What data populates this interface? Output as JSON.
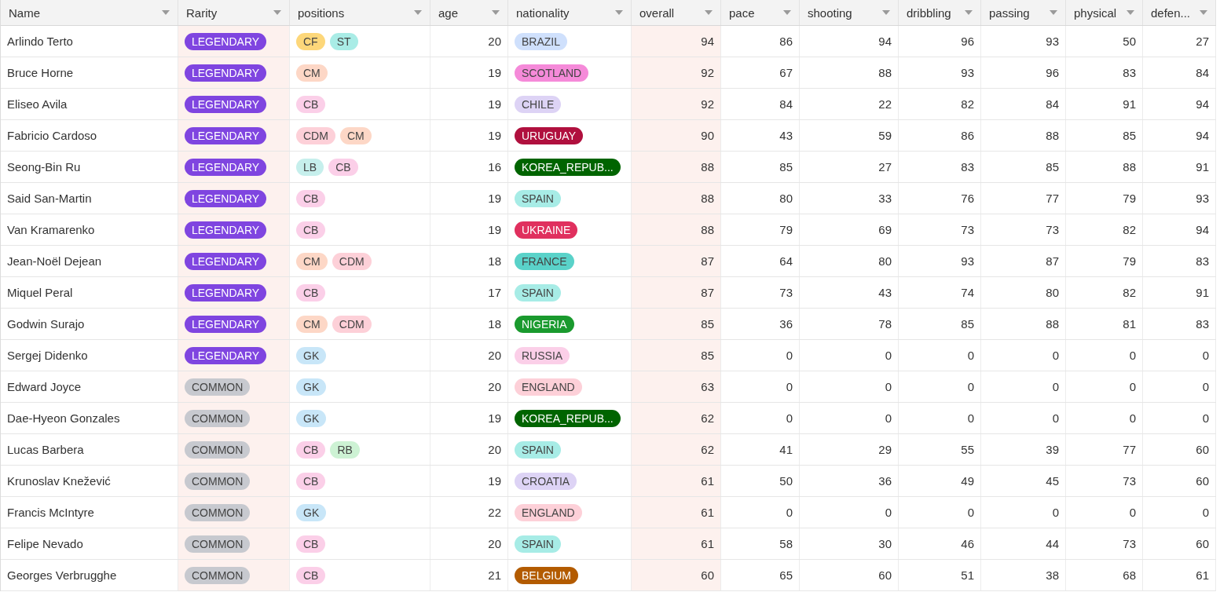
{
  "table": {
    "columns": [
      {
        "label": "Name",
        "kind": "text",
        "highlighted": false
      },
      {
        "label": "Rarity",
        "kind": "tag",
        "highlighted": true
      },
      {
        "label": "positions",
        "kind": "tags",
        "highlighted": false
      },
      {
        "label": "age",
        "kind": "number",
        "highlighted": false
      },
      {
        "label": "nationality",
        "kind": "tag",
        "highlighted": false
      },
      {
        "label": "overall",
        "kind": "number",
        "highlighted": true
      },
      {
        "label": "pace",
        "kind": "number",
        "highlighted": false
      },
      {
        "label": "shooting",
        "kind": "number",
        "highlighted": false
      },
      {
        "label": "dribbling",
        "kind": "number",
        "highlighted": false
      },
      {
        "label": "passing",
        "kind": "number",
        "highlighted": false
      },
      {
        "label": "physical",
        "kind": "number",
        "highlighted": false
      },
      {
        "label": "defen...",
        "kind": "number",
        "highlighted": false
      }
    ],
    "rows": [
      {
        "cells": [
          "Arlindo Terto",
          {
            "text": "LEGENDARY",
            "color": "#7f45e0"
          },
          [
            {
              "text": "CF",
              "color": "#fdd77a"
            },
            {
              "text": "ST",
              "color": "#a9ece6"
            }
          ],
          "20",
          {
            "text": "BRAZIL",
            "color": "#cfe0fc"
          },
          "94",
          "86",
          "94",
          "96",
          "93",
          "50",
          "27"
        ]
      },
      {
        "cells": [
          "Bruce Horne",
          {
            "text": "LEGENDARY",
            "color": "#7f45e0"
          },
          [
            {
              "text": "CM",
              "color": "#fdd7c6"
            }
          ],
          "19",
          {
            "text": "SCOTLAND",
            "color": "#f58ad9"
          },
          "92",
          "67",
          "88",
          "93",
          "96",
          "83",
          "84"
        ]
      },
      {
        "cells": [
          "Eliseo Avila",
          {
            "text": "LEGENDARY",
            "color": "#7f45e0"
          },
          [
            {
              "text": "CB",
              "color": "#fbcfe8"
            }
          ],
          "19",
          {
            "text": "CHILE",
            "color": "#ddd3f5"
          },
          "92",
          "84",
          "22",
          "82",
          "84",
          "91",
          "94"
        ]
      },
      {
        "cells": [
          "Fabricio Cardoso",
          {
            "text": "LEGENDARY",
            "color": "#7f45e0"
          },
          [
            {
              "text": "CDM",
              "color": "#fdd0d8"
            },
            {
              "text": "CM",
              "color": "#fdd7c6"
            }
          ],
          "19",
          {
            "text": "URUGUAY",
            "color": "#b0103e"
          },
          "90",
          "43",
          "59",
          "86",
          "88",
          "85",
          "94"
        ]
      },
      {
        "cells": [
          "Seong-Bin Ru",
          {
            "text": "LEGENDARY",
            "color": "#7f45e0"
          },
          [
            {
              "text": "LB",
              "color": "#c6efec"
            },
            {
              "text": "CB",
              "color": "#fbcfe8"
            }
          ],
          "16",
          {
            "text": "KOREA_REPUB...",
            "color": "#006400"
          },
          "88",
          "85",
          "27",
          "83",
          "85",
          "88",
          "91"
        ]
      },
      {
        "cells": [
          "Said San-Martin",
          {
            "text": "LEGENDARY",
            "color": "#7f45e0"
          },
          [
            {
              "text": "CB",
              "color": "#fbcfe8"
            }
          ],
          "19",
          {
            "text": "SPAIN",
            "color": "#a7ece6"
          },
          "88",
          "80",
          "33",
          "76",
          "77",
          "79",
          "93"
        ]
      },
      {
        "cells": [
          "Van Kramarenko",
          {
            "text": "LEGENDARY",
            "color": "#7f45e0"
          },
          [
            {
              "text": "CB",
              "color": "#fbcfe8"
            }
          ],
          "19",
          {
            "text": "UKRAINE",
            "color": "#e0305e"
          },
          "88",
          "79",
          "69",
          "73",
          "73",
          "82",
          "94"
        ]
      },
      {
        "cells": [
          "Jean-Noël Dejean",
          {
            "text": "LEGENDARY",
            "color": "#7f45e0"
          },
          [
            {
              "text": "CM",
              "color": "#fdd7c6"
            },
            {
              "text": "CDM",
              "color": "#fdd0d8"
            }
          ],
          "18",
          {
            "text": "FRANCE",
            "color": "#5ad2c9"
          },
          "87",
          "64",
          "80",
          "93",
          "87",
          "79",
          "83"
        ]
      },
      {
        "cells": [
          "Miquel Peral",
          {
            "text": "LEGENDARY",
            "color": "#7f45e0"
          },
          [
            {
              "text": "CB",
              "color": "#fbcfe8"
            }
          ],
          "17",
          {
            "text": "SPAIN",
            "color": "#a7ece6"
          },
          "87",
          "73",
          "43",
          "74",
          "80",
          "82",
          "91"
        ]
      },
      {
        "cells": [
          "Godwin Surajo",
          {
            "text": "LEGENDARY",
            "color": "#7f45e0"
          },
          [
            {
              "text": "CM",
              "color": "#fdd7c6"
            },
            {
              "text": "CDM",
              "color": "#fdd0d8"
            }
          ],
          "18",
          {
            "text": "NIGERIA",
            "color": "#1a9a2e"
          },
          "85",
          "36",
          "78",
          "85",
          "88",
          "81",
          "83"
        ]
      },
      {
        "cells": [
          "Sergej Didenko",
          {
            "text": "LEGENDARY",
            "color": "#7f45e0"
          },
          [
            {
              "text": "GK",
              "color": "#c8e6f8"
            }
          ],
          "20",
          {
            "text": "RUSSIA",
            "color": "#fbcfe8"
          },
          "85",
          "0",
          "0",
          "0",
          "0",
          "0",
          "0"
        ]
      },
      {
        "cells": [
          "Edward Joyce",
          {
            "text": "COMMON",
            "color": "#c7c9cf"
          },
          [
            {
              "text": "GK",
              "color": "#c8e6f8"
            }
          ],
          "20",
          {
            "text": "ENGLAND",
            "color": "#fdd0d8"
          },
          "63",
          "0",
          "0",
          "0",
          "0",
          "0",
          "0"
        ]
      },
      {
        "cells": [
          "Dae-Hyeon Gonzales",
          {
            "text": "COMMON",
            "color": "#c7c9cf"
          },
          [
            {
              "text": "GK",
              "color": "#c8e6f8"
            }
          ],
          "19",
          {
            "text": "KOREA_REPUB...",
            "color": "#006400"
          },
          "62",
          "0",
          "0",
          "0",
          "0",
          "0",
          "0"
        ]
      },
      {
        "cells": [
          "Lucas Barbera",
          {
            "text": "COMMON",
            "color": "#c7c9cf"
          },
          [
            {
              "text": "CB",
              "color": "#fbcfe8"
            },
            {
              "text": "RB",
              "color": "#cdf2d4"
            }
          ],
          "20",
          {
            "text": "SPAIN",
            "color": "#a7ece6"
          },
          "62",
          "41",
          "29",
          "55",
          "39",
          "77",
          "60"
        ]
      },
      {
        "cells": [
          "Krunoslav Knežević",
          {
            "text": "COMMON",
            "color": "#c7c9cf"
          },
          [
            {
              "text": "CB",
              "color": "#fbcfe8"
            }
          ],
          "19",
          {
            "text": "CROATIA",
            "color": "#ddd3f5"
          },
          "61",
          "50",
          "36",
          "49",
          "45",
          "73",
          "60"
        ]
      },
      {
        "cells": [
          "Francis McIntyre",
          {
            "text": "COMMON",
            "color": "#c7c9cf"
          },
          [
            {
              "text": "GK",
              "color": "#c8e6f8"
            }
          ],
          "22",
          {
            "text": "ENGLAND",
            "color": "#fdd0d8"
          },
          "61",
          "0",
          "0",
          "0",
          "0",
          "0",
          "0"
        ]
      },
      {
        "cells": [
          "Felipe Nevado",
          {
            "text": "COMMON",
            "color": "#c7c9cf"
          },
          [
            {
              "text": "CB",
              "color": "#fbcfe8"
            }
          ],
          "20",
          {
            "text": "SPAIN",
            "color": "#a7ece6"
          },
          "61",
          "58",
          "30",
          "46",
          "44",
          "73",
          "60"
        ]
      },
      {
        "cells": [
          "Georges Verbrugghe",
          {
            "text": "COMMON",
            "color": "#c7c9cf"
          },
          [
            {
              "text": "CB",
              "color": "#fbcfe8"
            }
          ],
          "21",
          {
            "text": "BELGIUM",
            "color": "#b35b00"
          },
          "60",
          "65",
          "60",
          "51",
          "38",
          "68",
          "61"
        ]
      }
    ]
  }
}
